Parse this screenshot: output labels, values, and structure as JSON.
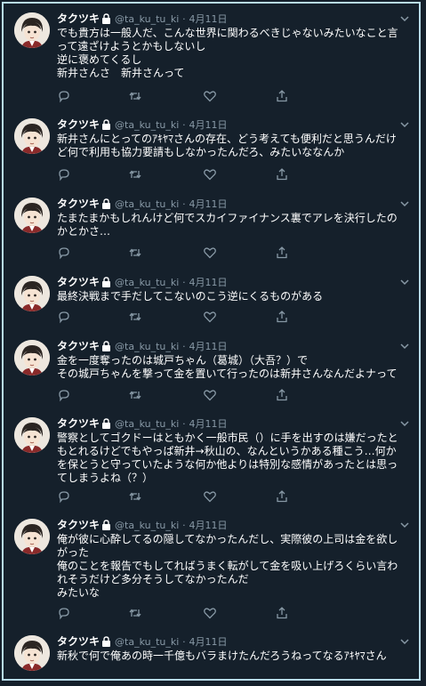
{
  "user": {
    "name": "タクツキ",
    "handle": "@ta_ku_tu_ki",
    "separator": "·"
  },
  "tweets": [
    {
      "date": "4月11日",
      "text": "でも貴方は一般人だ、こんな世界に関わるべきじゃないみたいなこと言って遠ざけようとかもしないし\n逆に褒めてくるし\n新井さんさ　新井さんって"
    },
    {
      "date": "4月11日",
      "text": "新井さんにとってのｱｷﾔﾏさんの存在、どう考えても便利だと思うんだけど何で利用も協力要請もしなかったんだろ、みたいななんか"
    },
    {
      "date": "4月11日",
      "text": "たまたまかもしれんけど何でスカイファイナンス裏でアレを決行したのかとかさ…"
    },
    {
      "date": "4月11日",
      "text": "最終決戦まで手だしてこないのこう逆にくるものがある"
    },
    {
      "date": "4月11日",
      "text": "金を一度奪ったのは城戸ちゃん（葛城）（大吾？）で\nその城戸ちゃんを撃って金を置いて行ったのは新井さんなんだよナって"
    },
    {
      "date": "4月11日",
      "text": "警察としてゴクドーはともかく一般市民（）に手を出すのは嫌だったともとれるけどでもやっぱ新井→秋山の、なんというかある種こう…何かを保とうと守っていたような何か他よりは特別な感情があったとは思ってしまうよね（？）"
    },
    {
      "date": "4月11日",
      "text": "俺が彼に心酔してるの隠してなかったんだし、実際彼の上司は金を欲しがった\n俺のことを報告でもしてればうまく転がして金を吸い上げろくらい言われそうだけど多分そうしてなかったんだ\nみたいな"
    },
    {
      "date": "4月11日",
      "text": "新秋で何で俺あの時一千億もバラまけたんだろうねってなるｱｷﾔﾏさん"
    }
  ],
  "icons": {
    "lock": "lock-icon",
    "more": "chevron-down-icon",
    "reply": "reply-icon",
    "retweet": "retweet-icon",
    "like": "like-icon",
    "share": "share-icon"
  },
  "colors": {
    "background": "#15202b",
    "border": "#38444d",
    "muted": "#8899a6",
    "frame": "#b7dbe8"
  }
}
